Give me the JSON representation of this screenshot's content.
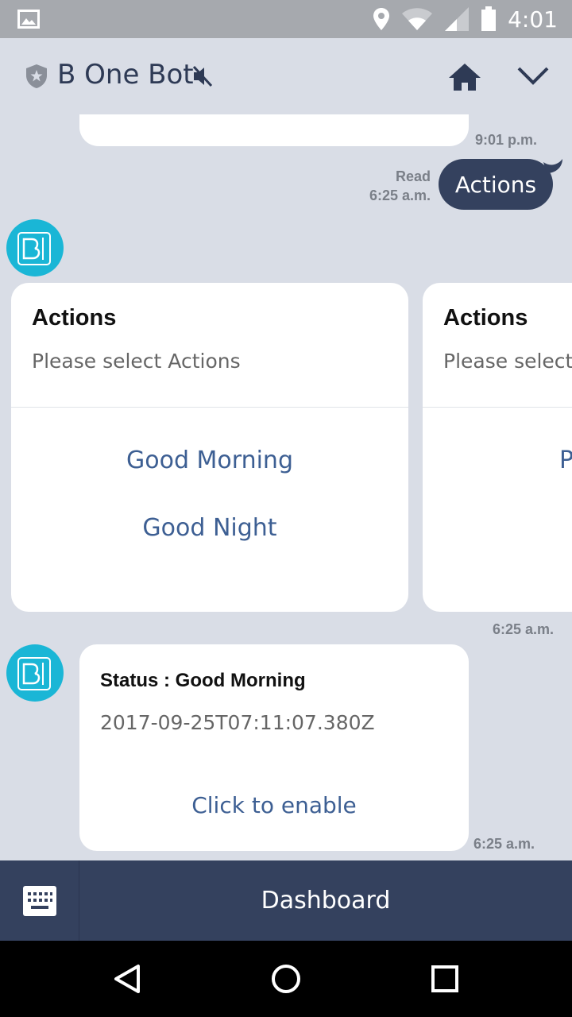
{
  "status_bar": {
    "time": "4:01"
  },
  "header": {
    "title": "B One Bot"
  },
  "messages": {
    "prev_time": "9:01 p.m.",
    "user_read": "Read",
    "user_time": "6:25 a.m.",
    "user_text": "Actions",
    "cards": [
      {
        "title": "Actions",
        "subtitle": "Please select Actions",
        "buttons": [
          "Good Morning",
          "Good Night"
        ]
      },
      {
        "title": "Actions",
        "subtitle": "Please select",
        "buttons": [
          "P"
        ]
      }
    ],
    "cards_time": "6:25 a.m.",
    "status_title": "Status : Good Morning",
    "status_date": "2017-09-25T07:11:07.380Z",
    "status_button": "Click to enable",
    "status_time": "6:25 a.m."
  },
  "bottom_bar": {
    "menu_label": "Dashboard"
  },
  "colors": {
    "accent": "#34415e",
    "link": "#3d5f93",
    "avatar": "#1ab6d6",
    "background": "#d9dde6"
  }
}
